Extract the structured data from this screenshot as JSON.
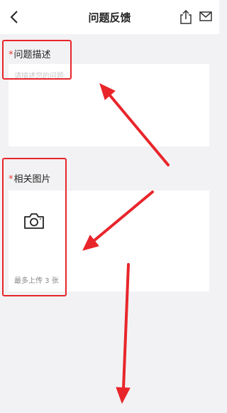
{
  "header": {
    "title": "问题反馈",
    "back_icon": "chevron-left-icon",
    "share_icon": "share-icon",
    "mail_icon": "mail-icon"
  },
  "description": {
    "required_mark": "*",
    "label": "问题描述",
    "placeholder": "请描述您的问题",
    "value": ""
  },
  "images": {
    "required_mark": "*",
    "label": "相关图片",
    "camera_icon": "camera-icon",
    "hint": "最多上传 3 张"
  },
  "annotation": {
    "highlight_color": "#e8252a",
    "arrow_color": "#e8252a"
  }
}
